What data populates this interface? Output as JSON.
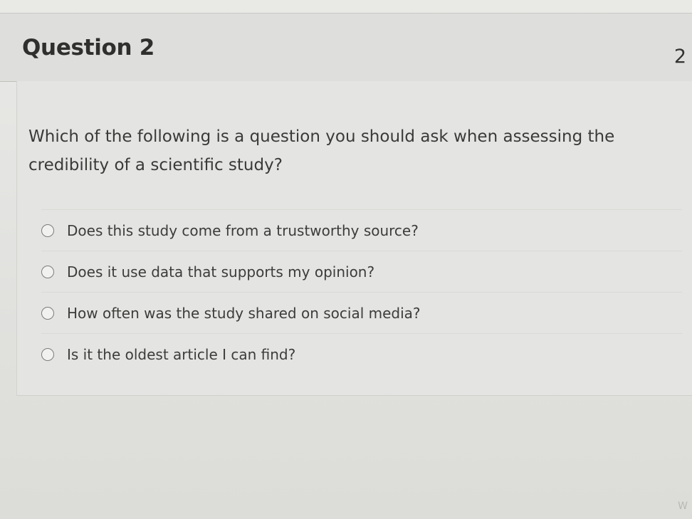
{
  "question": {
    "title": "Question 2",
    "points": "2",
    "text": "Which of the following is a question you should ask when assessing the credibility of a scientific study?",
    "answers": [
      {
        "label": "Does this study come from a trustworthy source?",
        "selected": false
      },
      {
        "label": "Does it use data that supports my opinion?",
        "selected": false
      },
      {
        "label": "How often was the study shared on social media?",
        "selected": false
      },
      {
        "label": "Is it the oldest article I can find?",
        "selected": false
      }
    ]
  },
  "footer": {
    "watermark_text": "W"
  }
}
